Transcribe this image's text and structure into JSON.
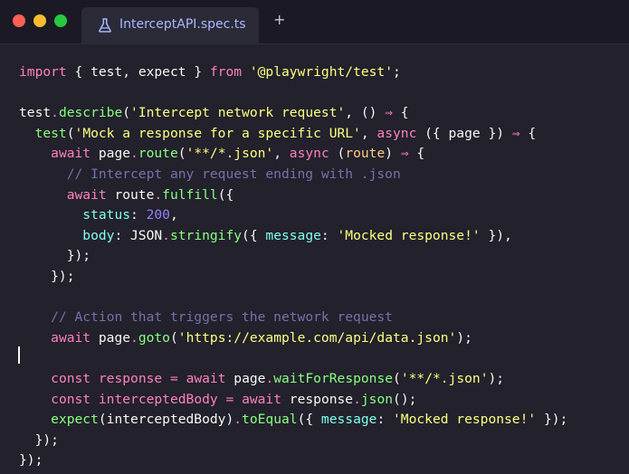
{
  "window": {
    "controls": [
      "close",
      "minimize",
      "maximize"
    ],
    "colors": {
      "close": "#ff5f57",
      "minimize": "#febc2e",
      "maximize": "#28c840"
    }
  },
  "tab": {
    "title": "InterceptAPI.spec.ts",
    "icon": "flask-icon"
  },
  "new_tab_label": "+",
  "editor": {
    "lines": [
      [
        [
          "kw",
          "import"
        ],
        [
          "obj",
          " { "
        ],
        [
          "obj",
          "test"
        ],
        [
          "obj",
          ", "
        ],
        [
          "obj",
          "expect"
        ],
        [
          "obj",
          " } "
        ],
        [
          "kw",
          "from"
        ],
        [
          "obj",
          " "
        ],
        [
          "str",
          "'@playwright/test'"
        ],
        [
          "obj",
          ";"
        ]
      ],
      [],
      [
        [
          "obj",
          "test"
        ],
        [
          "op",
          "."
        ],
        [
          "fn",
          "describe"
        ],
        [
          "obj",
          "("
        ],
        [
          "str",
          "'Intercept network request'"
        ],
        [
          "obj",
          ", () "
        ],
        [
          "op",
          "⇒"
        ],
        [
          "obj",
          " {"
        ]
      ],
      [
        [
          "obj",
          "  "
        ],
        [
          "fn",
          "test"
        ],
        [
          "obj",
          "("
        ],
        [
          "str",
          "'Mock a response for a specific URL'"
        ],
        [
          "obj",
          ", "
        ],
        [
          "kw",
          "async"
        ],
        [
          "obj",
          " ({ "
        ],
        [
          "obj",
          "page"
        ],
        [
          "obj",
          " }) "
        ],
        [
          "op",
          "⇒"
        ],
        [
          "obj",
          " {"
        ]
      ],
      [
        [
          "obj",
          "    "
        ],
        [
          "kw",
          "await"
        ],
        [
          "obj",
          " page"
        ],
        [
          "op",
          "."
        ],
        [
          "fn",
          "route"
        ],
        [
          "obj",
          "("
        ],
        [
          "str",
          "'**/*.json'"
        ],
        [
          "obj",
          ", "
        ],
        [
          "kw",
          "async"
        ],
        [
          "obj",
          " ("
        ],
        [
          "par",
          "route"
        ],
        [
          "obj",
          ") "
        ],
        [
          "op",
          "⇒"
        ],
        [
          "obj",
          " {"
        ]
      ],
      [
        [
          "obj",
          "      "
        ],
        [
          "cmt",
          "// Intercept any request ending with .json"
        ]
      ],
      [
        [
          "obj",
          "      "
        ],
        [
          "kw",
          "await"
        ],
        [
          "obj",
          " route"
        ],
        [
          "op",
          "."
        ],
        [
          "fn",
          "fulfill"
        ],
        [
          "obj",
          "({"
        ]
      ],
      [
        [
          "obj",
          "        "
        ],
        [
          "prop",
          "status"
        ],
        [
          "obj",
          ": "
        ],
        [
          "num",
          "200"
        ],
        [
          "obj",
          ","
        ]
      ],
      [
        [
          "obj",
          "        "
        ],
        [
          "prop",
          "body"
        ],
        [
          "obj",
          ": JSON"
        ],
        [
          "op",
          "."
        ],
        [
          "fn",
          "stringify"
        ],
        [
          "obj",
          "({ "
        ],
        [
          "prop",
          "message"
        ],
        [
          "obj",
          ": "
        ],
        [
          "str",
          "'Mocked response!'"
        ],
        [
          "obj",
          " }),"
        ]
      ],
      [
        [
          "obj",
          "      });"
        ]
      ],
      [
        [
          "obj",
          "    });"
        ]
      ],
      [],
      [
        [
          "obj",
          "    "
        ],
        [
          "cmt",
          "// Action that triggers the network request"
        ]
      ],
      [
        [
          "obj",
          "    "
        ],
        [
          "kw",
          "await"
        ],
        [
          "obj",
          " page"
        ],
        [
          "op",
          "."
        ],
        [
          "fn",
          "goto"
        ],
        [
          "obj",
          "("
        ],
        [
          "str",
          "'https://example.com/api/data.json'"
        ],
        [
          "obj",
          ");"
        ]
      ],
      [],
      [
        [
          "obj",
          "    "
        ],
        [
          "kw",
          "const"
        ],
        [
          "obj",
          " "
        ],
        [
          "kw",
          "response"
        ],
        [
          "obj",
          " "
        ],
        [
          "op",
          "="
        ],
        [
          "obj",
          " "
        ],
        [
          "kw",
          "await"
        ],
        [
          "obj",
          " page"
        ],
        [
          "op",
          "."
        ],
        [
          "fn",
          "waitForResponse"
        ],
        [
          "obj",
          "("
        ],
        [
          "str",
          "'**/*.json'"
        ],
        [
          "obj",
          ");"
        ]
      ],
      [
        [
          "obj",
          "    "
        ],
        [
          "kw",
          "const"
        ],
        [
          "obj",
          " "
        ],
        [
          "kw",
          "interceptedBody"
        ],
        [
          "obj",
          " "
        ],
        [
          "op",
          "="
        ],
        [
          "obj",
          " "
        ],
        [
          "kw",
          "await"
        ],
        [
          "obj",
          " response"
        ],
        [
          "op",
          "."
        ],
        [
          "fn",
          "json"
        ],
        [
          "obj",
          "();"
        ]
      ],
      [
        [
          "obj",
          "    "
        ],
        [
          "fn",
          "expect"
        ],
        [
          "obj",
          "(interceptedBody)"
        ],
        [
          "op",
          "."
        ],
        [
          "fn",
          "toEqual"
        ],
        [
          "obj",
          "({ "
        ],
        [
          "prop",
          "message"
        ],
        [
          "obj",
          ": "
        ],
        [
          "str",
          "'Mocked response!'"
        ],
        [
          "obj",
          " });"
        ]
      ],
      [
        [
          "obj",
          "  });"
        ]
      ],
      [
        [
          "obj",
          "});"
        ]
      ]
    ]
  }
}
